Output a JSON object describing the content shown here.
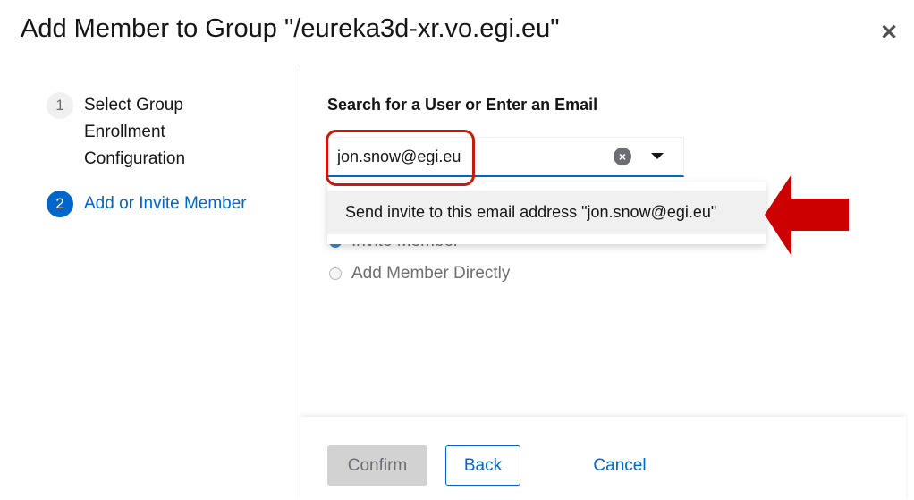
{
  "modal": {
    "title": "Add Member to Group \"/eureka3d-xr.vo.egi.eu\"",
    "close_icon": "times-icon"
  },
  "wizard": {
    "steps": [
      {
        "number": "1",
        "label_lines": [
          "Select Group",
          "Enrollment",
          "Configuration"
        ]
      },
      {
        "number": "2",
        "label": "Add or Invite Member"
      }
    ]
  },
  "form": {
    "heading": "Search for a User or Enter an Email",
    "input_value": "jon.snow@egi.eu",
    "dropdown_option": "Send invite to this email address \"jon.snow@egi.eu\"",
    "radios": [
      {
        "label": "Invite Member",
        "checked": true
      },
      {
        "label": "Add Member Directly",
        "checked": false
      }
    ]
  },
  "footer": {
    "confirm": "Confirm",
    "back": "Back",
    "cancel": "Cancel"
  },
  "colors": {
    "accent": "#0066cc",
    "annotation": "#c9190b"
  }
}
